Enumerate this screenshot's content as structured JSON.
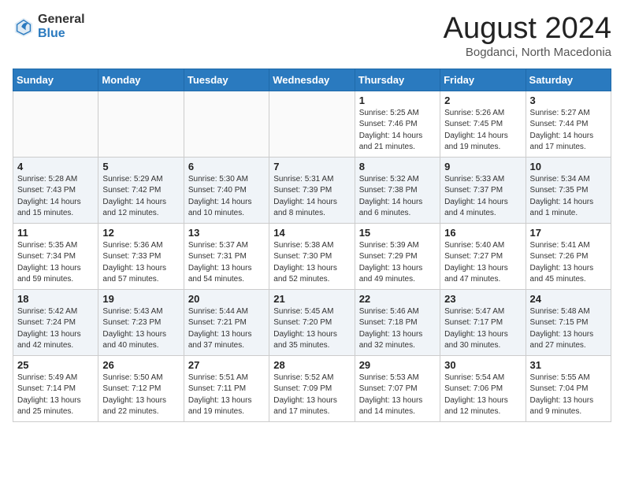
{
  "header": {
    "logo_general": "General",
    "logo_blue": "Blue",
    "month_year": "August 2024",
    "location": "Bogdanci, North Macedonia"
  },
  "weekdays": [
    "Sunday",
    "Monday",
    "Tuesday",
    "Wednesday",
    "Thursday",
    "Friday",
    "Saturday"
  ],
  "weeks": [
    [
      {
        "day": "",
        "info": ""
      },
      {
        "day": "",
        "info": ""
      },
      {
        "day": "",
        "info": ""
      },
      {
        "day": "",
        "info": ""
      },
      {
        "day": "1",
        "info": "Sunrise: 5:25 AM\nSunset: 7:46 PM\nDaylight: 14 hours\nand 21 minutes."
      },
      {
        "day": "2",
        "info": "Sunrise: 5:26 AM\nSunset: 7:45 PM\nDaylight: 14 hours\nand 19 minutes."
      },
      {
        "day": "3",
        "info": "Sunrise: 5:27 AM\nSunset: 7:44 PM\nDaylight: 14 hours\nand 17 minutes."
      }
    ],
    [
      {
        "day": "4",
        "info": "Sunrise: 5:28 AM\nSunset: 7:43 PM\nDaylight: 14 hours\nand 15 minutes."
      },
      {
        "day": "5",
        "info": "Sunrise: 5:29 AM\nSunset: 7:42 PM\nDaylight: 14 hours\nand 12 minutes."
      },
      {
        "day": "6",
        "info": "Sunrise: 5:30 AM\nSunset: 7:40 PM\nDaylight: 14 hours\nand 10 minutes."
      },
      {
        "day": "7",
        "info": "Sunrise: 5:31 AM\nSunset: 7:39 PM\nDaylight: 14 hours\nand 8 minutes."
      },
      {
        "day": "8",
        "info": "Sunrise: 5:32 AM\nSunset: 7:38 PM\nDaylight: 14 hours\nand 6 minutes."
      },
      {
        "day": "9",
        "info": "Sunrise: 5:33 AM\nSunset: 7:37 PM\nDaylight: 14 hours\nand 4 minutes."
      },
      {
        "day": "10",
        "info": "Sunrise: 5:34 AM\nSunset: 7:35 PM\nDaylight: 14 hours\nand 1 minute."
      }
    ],
    [
      {
        "day": "11",
        "info": "Sunrise: 5:35 AM\nSunset: 7:34 PM\nDaylight: 13 hours\nand 59 minutes."
      },
      {
        "day": "12",
        "info": "Sunrise: 5:36 AM\nSunset: 7:33 PM\nDaylight: 13 hours\nand 57 minutes."
      },
      {
        "day": "13",
        "info": "Sunrise: 5:37 AM\nSunset: 7:31 PM\nDaylight: 13 hours\nand 54 minutes."
      },
      {
        "day": "14",
        "info": "Sunrise: 5:38 AM\nSunset: 7:30 PM\nDaylight: 13 hours\nand 52 minutes."
      },
      {
        "day": "15",
        "info": "Sunrise: 5:39 AM\nSunset: 7:29 PM\nDaylight: 13 hours\nand 49 minutes."
      },
      {
        "day": "16",
        "info": "Sunrise: 5:40 AM\nSunset: 7:27 PM\nDaylight: 13 hours\nand 47 minutes."
      },
      {
        "day": "17",
        "info": "Sunrise: 5:41 AM\nSunset: 7:26 PM\nDaylight: 13 hours\nand 45 minutes."
      }
    ],
    [
      {
        "day": "18",
        "info": "Sunrise: 5:42 AM\nSunset: 7:24 PM\nDaylight: 13 hours\nand 42 minutes."
      },
      {
        "day": "19",
        "info": "Sunrise: 5:43 AM\nSunset: 7:23 PM\nDaylight: 13 hours\nand 40 minutes."
      },
      {
        "day": "20",
        "info": "Sunrise: 5:44 AM\nSunset: 7:21 PM\nDaylight: 13 hours\nand 37 minutes."
      },
      {
        "day": "21",
        "info": "Sunrise: 5:45 AM\nSunset: 7:20 PM\nDaylight: 13 hours\nand 35 minutes."
      },
      {
        "day": "22",
        "info": "Sunrise: 5:46 AM\nSunset: 7:18 PM\nDaylight: 13 hours\nand 32 minutes."
      },
      {
        "day": "23",
        "info": "Sunrise: 5:47 AM\nSunset: 7:17 PM\nDaylight: 13 hours\nand 30 minutes."
      },
      {
        "day": "24",
        "info": "Sunrise: 5:48 AM\nSunset: 7:15 PM\nDaylight: 13 hours\nand 27 minutes."
      }
    ],
    [
      {
        "day": "25",
        "info": "Sunrise: 5:49 AM\nSunset: 7:14 PM\nDaylight: 13 hours\nand 25 minutes."
      },
      {
        "day": "26",
        "info": "Sunrise: 5:50 AM\nSunset: 7:12 PM\nDaylight: 13 hours\nand 22 minutes."
      },
      {
        "day": "27",
        "info": "Sunrise: 5:51 AM\nSunset: 7:11 PM\nDaylight: 13 hours\nand 19 minutes."
      },
      {
        "day": "28",
        "info": "Sunrise: 5:52 AM\nSunset: 7:09 PM\nDaylight: 13 hours\nand 17 minutes."
      },
      {
        "day": "29",
        "info": "Sunrise: 5:53 AM\nSunset: 7:07 PM\nDaylight: 13 hours\nand 14 minutes."
      },
      {
        "day": "30",
        "info": "Sunrise: 5:54 AM\nSunset: 7:06 PM\nDaylight: 13 hours\nand 12 minutes."
      },
      {
        "day": "31",
        "info": "Sunrise: 5:55 AM\nSunset: 7:04 PM\nDaylight: 13 hours\nand 9 minutes."
      }
    ]
  ]
}
